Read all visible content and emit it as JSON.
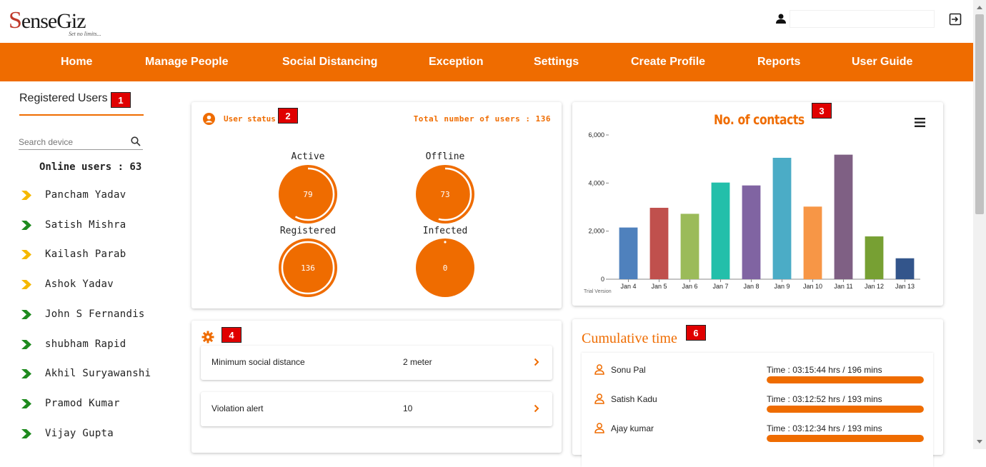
{
  "brand": {
    "logo_initial": "S",
    "logo_rest": "enseGiz",
    "tagline": "Set no limits...",
    "accent": "#ef6c00"
  },
  "nav": [
    {
      "label": "Home"
    },
    {
      "label": "Manage People"
    },
    {
      "label": "Social Distancing"
    },
    {
      "label": "Exception"
    },
    {
      "label": "Settings"
    },
    {
      "label": "Create Profile"
    },
    {
      "label": "Reports"
    },
    {
      "label": "User Guide"
    }
  ],
  "sidebar": {
    "title": "Registered Users",
    "search_placeholder": "Search device",
    "online_text": "Online users : 63",
    "devices": [
      {
        "name": "Pancham Yadav",
        "status": "idle",
        "color": "#f5b800"
      },
      {
        "name": "Satish Mishra",
        "status": "online",
        "color": "#1e8a1e"
      },
      {
        "name": "Kailash Parab",
        "status": "idle",
        "color": "#f5b800"
      },
      {
        "name": "Ashok Yadav",
        "status": "idle",
        "color": "#f5b800"
      },
      {
        "name": "John S Fernandis",
        "status": "online",
        "color": "#1e8a1e"
      },
      {
        "name": "shubham Rapid",
        "status": "online",
        "color": "#1e8a1e"
      },
      {
        "name": "Akhil Suryawanshi",
        "status": "online",
        "color": "#1e8a1e"
      },
      {
        "name": "Pramod Kumar",
        "status": "online",
        "color": "#1e8a1e"
      },
      {
        "name": "Vijay Gupta",
        "status": "online",
        "color": "#1e8a1e"
      }
    ]
  },
  "markers": [
    "1",
    "2",
    "3",
    "4",
    "6"
  ],
  "user_status": {
    "title": "User status",
    "total_text": "Total number of users : 136",
    "gauges": [
      {
        "label": "Active",
        "value": "79",
        "fraction": 0.58
      },
      {
        "label": "Offline",
        "value": "73",
        "fraction": 0.54
      },
      {
        "label": "Registered",
        "value": "136",
        "fraction": 1.0
      },
      {
        "label": "Infected",
        "value": "0",
        "fraction": 0.0
      }
    ]
  },
  "chart_data": {
    "type": "bar",
    "title": "No. of contacts",
    "categories": [
      "Jan 4",
      "Jan 5",
      "Jan 6",
      "Jan 7",
      "Jan 8",
      "Jan 9",
      "Jan 10",
      "Jan 11",
      "Jan 12",
      "Jan 13"
    ],
    "values": [
      2150,
      2970,
      2720,
      4020,
      3900,
      5050,
      3020,
      5180,
      1780,
      870
    ],
    "colors": [
      "#4f81bd",
      "#c0504d",
      "#9bbb59",
      "#23bfaa",
      "#8064a2",
      "#4bacc6",
      "#f79646",
      "#7f6084",
      "#77a033",
      "#33558b"
    ],
    "ylim": [
      0,
      6000
    ],
    "yticks": [
      "0",
      "2,000",
      "4,000",
      "6,000"
    ],
    "ytick_values": [
      0,
      2000,
      4000,
      6000
    ],
    "xlabel": "",
    "ylabel": "",
    "grid": false,
    "watermark": "Trial Version"
  },
  "settings": {
    "rows": [
      {
        "label": "Minimum social distance",
        "value": "2 meter"
      },
      {
        "label": "Violation alert",
        "value": "10"
      }
    ]
  },
  "cumulative": {
    "title": "Cumulative time",
    "rows": [
      {
        "name": "Sonu Pal",
        "time": "Time : 03:15:44 hrs / 196 mins",
        "fraction": 1.0
      },
      {
        "name": "Satish Kadu",
        "time": "Time : 03:12:52 hrs / 193 mins",
        "fraction": 1.0
      },
      {
        "name": "Ajay kumar",
        "time": "Time : 03:12:34 hrs / 193 mins",
        "fraction": 1.0
      }
    ]
  }
}
